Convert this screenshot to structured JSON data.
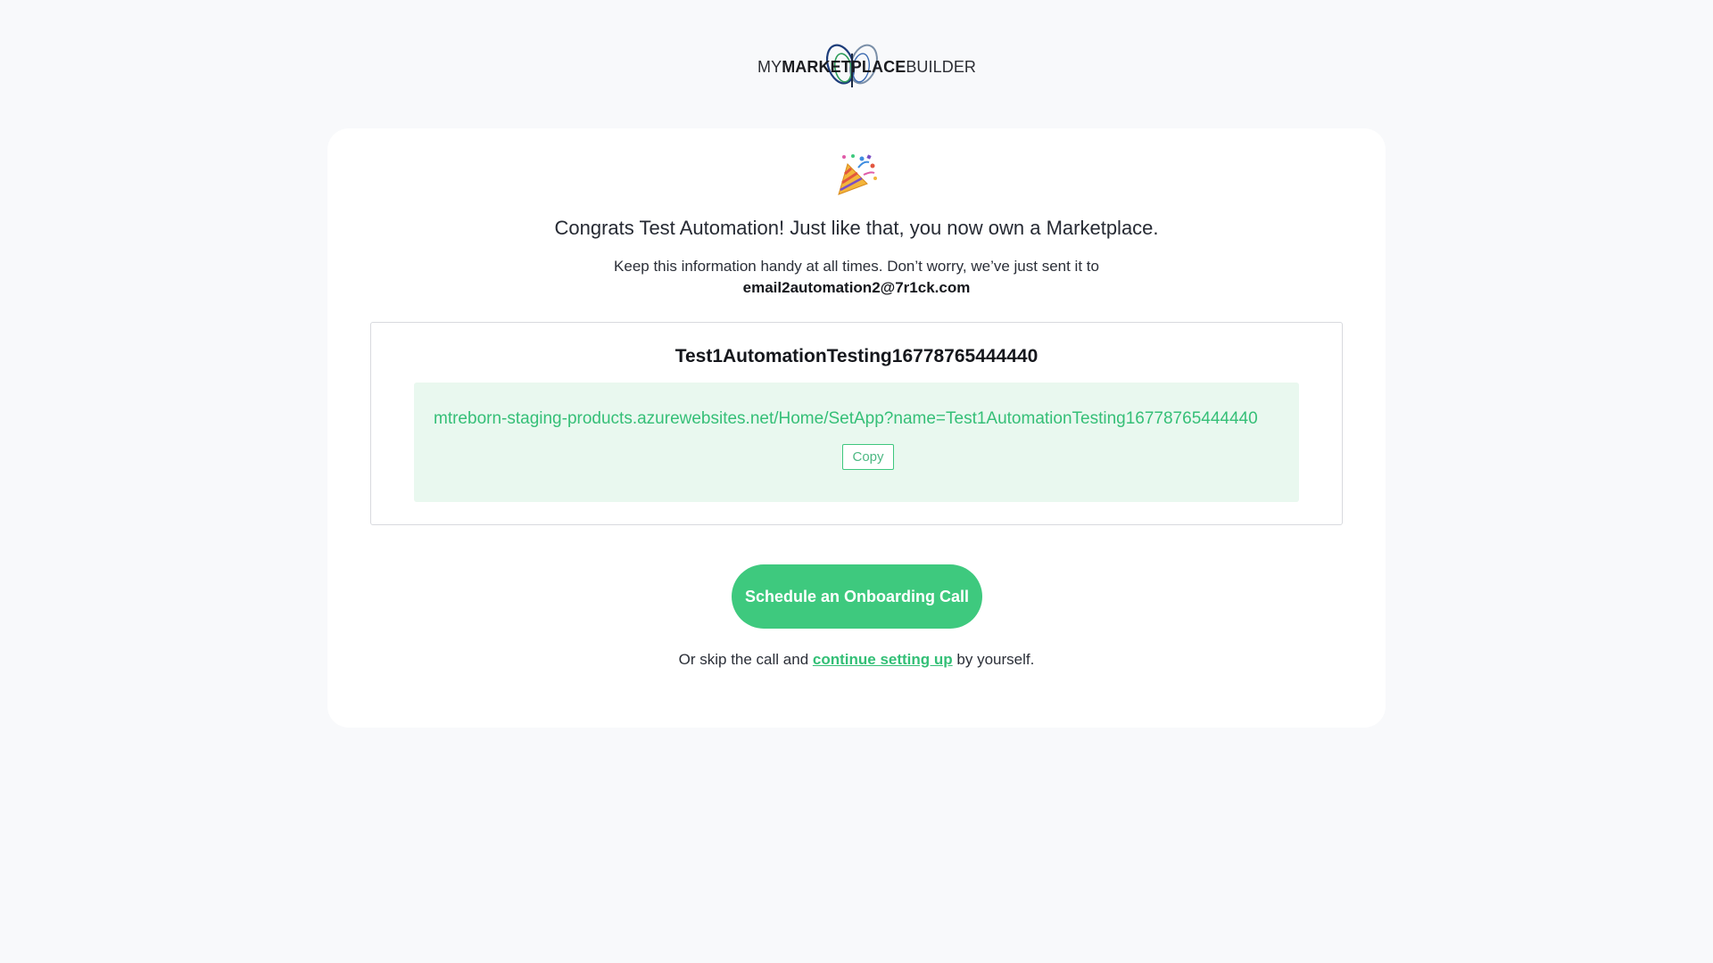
{
  "logo": {
    "prefix": "MY",
    "middle": "MARKETPLACE",
    "suffix": "BUILDER"
  },
  "celebration_icon": "party-popper",
  "headline": "Congrats Test Automation! Just like that, you now own a Marketplace.",
  "subline": "Keep this information handy at all times. Don’t worry, we’ve just sent it to",
  "email": "email2automation2@7r1ck.com",
  "app": {
    "name": "Test1AutomationTesting16778765444440",
    "url": "mtreborn-staging-products.azurewebsites.net/Home/SetApp?name=Test1AutomationTesting16778765444440",
    "copy_label": "Copy"
  },
  "cta": {
    "label": "Schedule an Onboarding Call"
  },
  "skip": {
    "before": "Or skip the call and",
    "link": "continue setting up",
    "after": "by yourself."
  },
  "colors": {
    "accent": "#3ec97e",
    "url_panel": "#e9f8ef",
    "background": "#f8f9fb"
  }
}
